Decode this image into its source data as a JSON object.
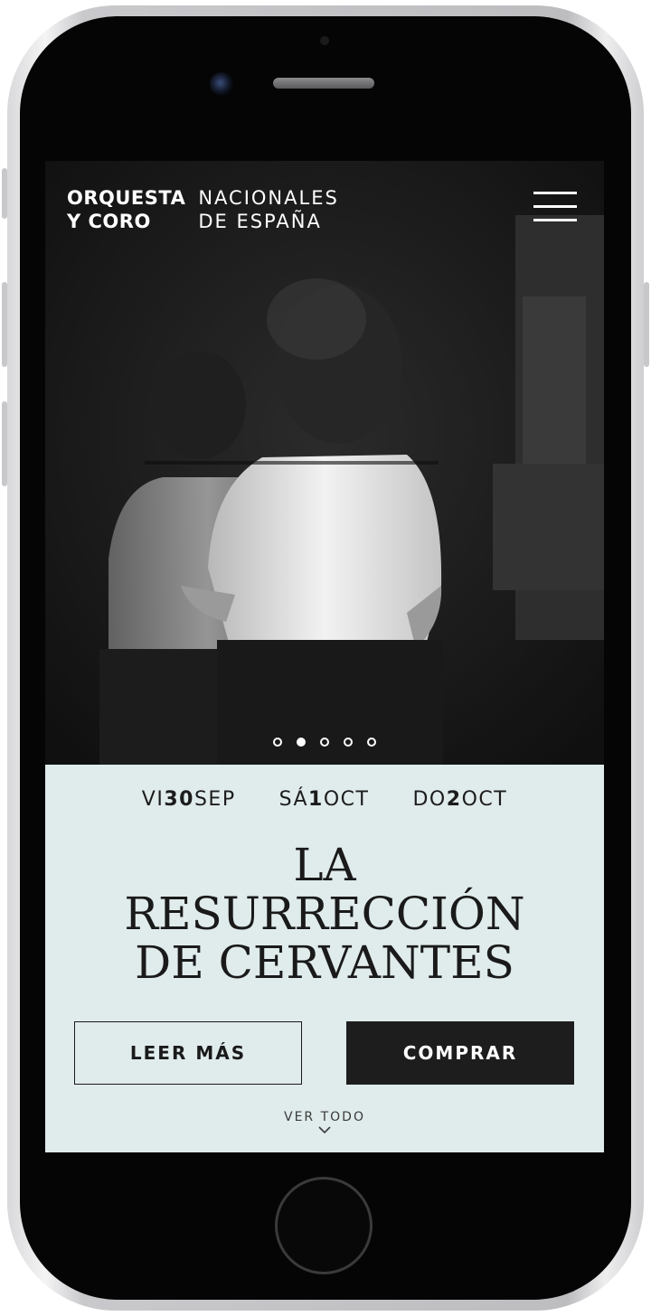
{
  "header": {
    "logo_line1_bold": "ORQUESTA",
    "logo_line2_bold": "Y CORO",
    "logo_line1_light": "NACIONALES",
    "logo_line2_light": "DE ESPAÑA",
    "menu_icon": "hamburger-menu-icon"
  },
  "carousel": {
    "slide_count": 5,
    "active_index": 1
  },
  "dates": [
    {
      "day": "VI",
      "num": "30",
      "month": "SEP"
    },
    {
      "day": "SÁ",
      "num": "1",
      "month": "OCT"
    },
    {
      "day": "DO",
      "num": "2",
      "month": "OCT"
    }
  ],
  "event": {
    "title_line1": "LA",
    "title_line2": "RESURRECCIÓN",
    "title_line3": "DE CERVANTES"
  },
  "actions": {
    "read_more": "LEER MÁS",
    "buy": "COMPRAR",
    "see_all": "VER TODO"
  },
  "colors": {
    "panel_bg": "#e0ebeb",
    "buy_button_bg": "#1d1d1d",
    "hero_bg": "#161616"
  }
}
